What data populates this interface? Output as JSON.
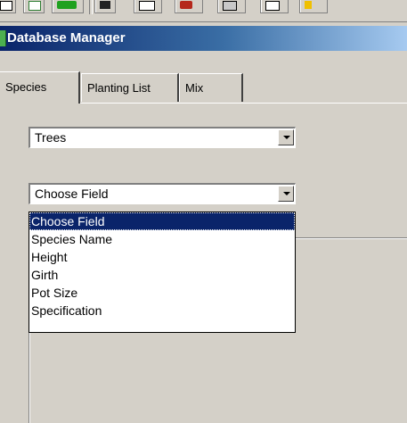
{
  "window": {
    "title": "Database Manager"
  },
  "toolbar": {
    "icons": [
      "toolbar-icon-1",
      "toolbar-icon-2",
      "toolbar-icon-3",
      "toolbar-icon-4",
      "toolbar-icon-5",
      "toolbar-icon-6",
      "toolbar-icon-7",
      "toolbar-icon-8"
    ]
  },
  "tabs": [
    {
      "label": "Species",
      "active": true
    },
    {
      "label": "Planting List",
      "active": false
    },
    {
      "label": "Mix",
      "active": false
    }
  ],
  "type_combo": {
    "value": "Trees"
  },
  "field_combo": {
    "value": "Choose Field",
    "options": [
      "Choose Field",
      "Species Name",
      "Height",
      "Girth",
      "Pot Size",
      "Specification"
    ],
    "highlighted": "Choose Field"
  },
  "colors": {
    "titlebar_start": "#0a246a",
    "titlebar_end": "#a6caf0",
    "selection": "#0a246a",
    "face": "#d4d0c8"
  }
}
